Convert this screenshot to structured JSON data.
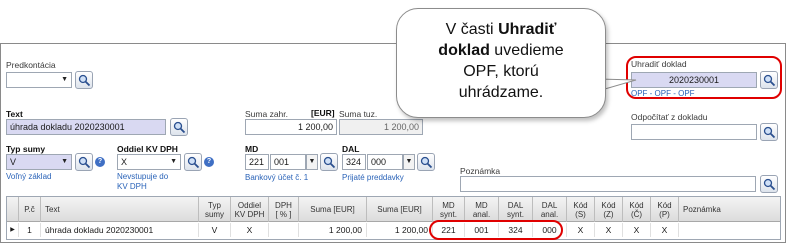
{
  "form": {
    "predkontacia_label": "Predkontácia",
    "text_label": "Text",
    "text_value": "úhrada dokladu 2020230001",
    "suma_zahr_label": "Suma zahr.",
    "currency_label": "[EUR]",
    "suma_zahr_value": "1 200,00",
    "suma_tuz_label": "Suma tuz.",
    "suma_tuz_value": "1 200,00",
    "typ_sumy_label": "Typ sumy",
    "typ_sumy_value": "V",
    "typ_sumy_desc": "Voľný základ",
    "oddiel_label": "Oddiel KV DPH",
    "oddiel_value": "X",
    "oddiel_desc": "Nevstupuje do KV DPH",
    "md_label": "MD",
    "md_synt": "221",
    "md_anal": "001",
    "md_desc": "Bankový účet č. 1",
    "dal_label": "DAL",
    "dal_synt": "324",
    "dal_anal": "000",
    "dal_desc": "Prijaté preddavky",
    "uhradit_label": "Uhradiť doklad",
    "uhradit_value": "2020230001",
    "uhradit_desc": "OPF - OPF - OPF",
    "odpocitat_label": "Odpočítať z dokladu",
    "poznamka_label": "Poznámka"
  },
  "callout": {
    "line1_pre": "V časti ",
    "line1_bold": "Uhradiť",
    "line2_bold": "doklad",
    "line2_post": " uvedieme",
    "line3": "OPF, ktorú",
    "line4": "uhrádzame."
  },
  "grid": {
    "headers": [
      "",
      "P.č",
      "Text",
      "Typ\nsumy",
      "Oddiel\nKV DPH",
      "DPH\n[ % ]",
      "Suma [EUR]",
      "Suma [EUR]",
      "MD\nsynt.",
      "MD\nanal.",
      "DAL\nsynt.",
      "DAL\nanal.",
      "Kód\n(S)",
      "Kód\n(Z)",
      "Kód\n(Č)",
      "Kód\n(P)",
      "Poznámka"
    ],
    "row": {
      "marker": "▶",
      "pc": "1",
      "text": "úhrada dokladu 2020230001",
      "typ": "V",
      "oddiel": "X",
      "dph": "",
      "suma1": "1 200,00",
      "suma2": "1 200,00",
      "md_synt": "221",
      "md_anal": "001",
      "dal_synt": "324",
      "dal_anal": "000",
      "kod_s": "X",
      "kod_z": "X",
      "kod_c": "X",
      "kod_p": "X",
      "poznamka": ""
    }
  },
  "colors": {
    "highlight_red": "#e00000",
    "link_blue": "#2a63b8",
    "filled_field": "#d9d9f2"
  },
  "icons": [
    "search-lookup-icon",
    "dropdown-arrow-icon",
    "help-icon",
    "row-marker-icon"
  ]
}
